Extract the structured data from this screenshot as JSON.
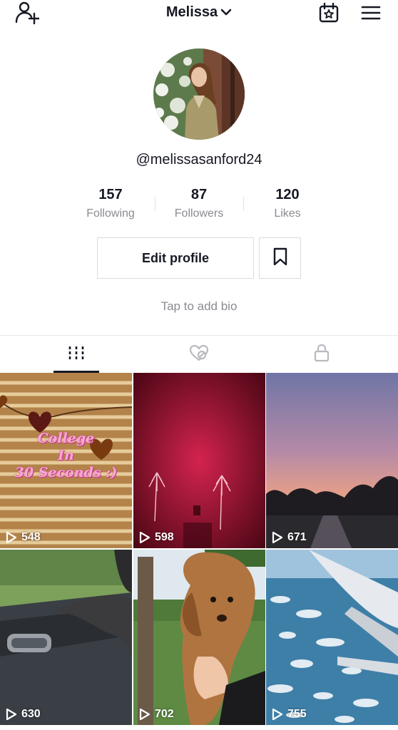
{
  "header": {
    "username": "Melissa",
    "icons": [
      "add-user-icon",
      "chevron-down-icon",
      "calendar-star-icon",
      "menu-icon"
    ]
  },
  "profile": {
    "handle": "@melissasanford24",
    "stats": [
      {
        "value": "157",
        "label": "Following"
      },
      {
        "value": "87",
        "label": "Followers"
      },
      {
        "value": "120",
        "label": "Likes"
      }
    ],
    "edit_label": "Edit profile",
    "bio_placeholder": "Tap to add bio"
  },
  "tabs": [
    {
      "icon": "grid-icon",
      "active": true
    },
    {
      "icon": "liked-icon",
      "active": false
    },
    {
      "icon": "lock-icon",
      "active": false
    }
  ],
  "videos": [
    {
      "views": "548",
      "caption": [
        "College",
        "In",
        "30 Seconds :)"
      ]
    },
    {
      "views": "598"
    },
    {
      "views": "671"
    },
    {
      "views": "630"
    },
    {
      "views": "702"
    },
    {
      "views": "755"
    }
  ],
  "colors": {
    "text": "#161823",
    "muted": "#8a8b91",
    "border": "#dcdcdf"
  }
}
